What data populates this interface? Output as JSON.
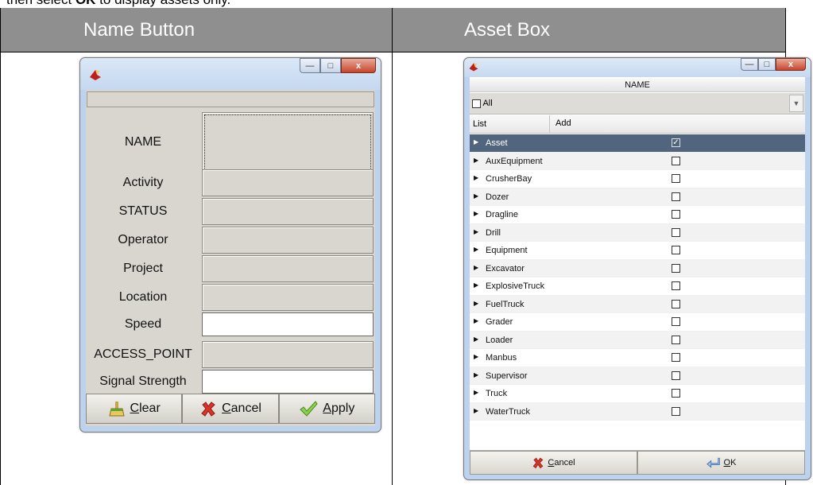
{
  "intro_text": {
    "before": "then select ",
    "bold": "OK",
    "after": " to display assets only."
  },
  "columns": {
    "left_header": "Name Button",
    "right_header": "Asset Box"
  },
  "name_dialog": {
    "fields": [
      {
        "label": "NAME",
        "kind": "grey-dotted"
      },
      {
        "label": "Activity",
        "kind": "grey"
      },
      {
        "label": "STATUS",
        "kind": "grey"
      },
      {
        "label": "Operator",
        "kind": "grey"
      },
      {
        "label": "Project",
        "kind": "grey"
      },
      {
        "label": "Location",
        "kind": "grey"
      },
      {
        "label": "Speed",
        "kind": "white"
      },
      {
        "label": "ACCESS_POINT",
        "kind": "grey"
      },
      {
        "label": "Signal Strength",
        "kind": "white"
      }
    ],
    "buttons": {
      "clear": {
        "pre": "",
        "acc": "C",
        "post": "lear"
      },
      "cancel": {
        "pre": "",
        "acc": "C",
        "post": "ancel"
      },
      "apply": {
        "pre": "",
        "acc": "A",
        "post": "pply"
      }
    }
  },
  "asset_dialog": {
    "name_header": "NAME",
    "all_label": "All",
    "col_list": "List",
    "col_add": "Add",
    "items": [
      {
        "name": "Asset",
        "checked": true,
        "selected": true
      },
      {
        "name": "AuxEquipment",
        "checked": false
      },
      {
        "name": "CrusherBay",
        "checked": false
      },
      {
        "name": "Dozer",
        "checked": false
      },
      {
        "name": "Dragline",
        "checked": false
      },
      {
        "name": "Drill",
        "checked": false
      },
      {
        "name": "Equipment",
        "checked": false
      },
      {
        "name": "Excavator",
        "checked": false
      },
      {
        "name": "ExplosiveTruck",
        "checked": false
      },
      {
        "name": "FuelTruck",
        "checked": false
      },
      {
        "name": "Grader",
        "checked": false
      },
      {
        "name": "Loader",
        "checked": false
      },
      {
        "name": "Manbus",
        "checked": false
      },
      {
        "name": "Supervisor",
        "checked": false
      },
      {
        "name": "Truck",
        "checked": false
      },
      {
        "name": "WaterTruck",
        "checked": false
      }
    ],
    "buttons": {
      "cancel": {
        "acc": "C",
        "post": "ancel"
      },
      "ok": {
        "acc": "O",
        "post": "K"
      }
    }
  },
  "colors": {
    "header_bg": "#8f8f8f",
    "selected_row": "#51667e",
    "dialog_body": "#d8d6cf"
  }
}
